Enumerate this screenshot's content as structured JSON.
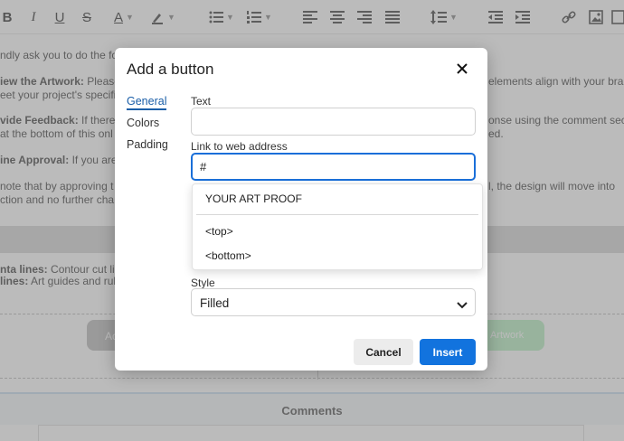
{
  "document": {
    "lines": [
      {
        "text": "ndly ask you to do the foll",
        "bold": false
      },
      {
        "text": "iew the Artwork:",
        "bold": true,
        "rest": " Please"
      },
      {
        "text": "eet your project's specifi",
        "bold": false
      },
      {
        "text": "vide Feedback:",
        "bold": true,
        "rest": " If there a"
      },
      {
        "text": "at the bottom of this onl",
        "bold": false
      },
      {
        "text": "ine Approval:",
        "bold": true,
        "rest": " If you are"
      },
      {
        "text": " note that by approving t",
        "bold": false
      },
      {
        "text": "ction and no further chan",
        "bold": false
      },
      {
        "text": "nta lines:",
        "bold": true,
        "rest": " Contour cut lin"
      },
      {
        "text": "lines:",
        "bold": true,
        "rest": " Art guides and rule"
      }
    ],
    "right_lines": [
      "elements align with your bran",
      "onse using the comment secti",
      "ed.",
      "l, the design will move into"
    ],
    "bg_button_left": "Ac",
    "bg_button_right": "Artwork",
    "comments_heading": "Comments"
  },
  "dialog": {
    "title": "Add a button",
    "tabs": [
      "General",
      "Colors",
      "Padding"
    ],
    "text_label": "Text",
    "text_value": "",
    "link_label": "Link to web address",
    "link_value": "#",
    "dropdown_items": [
      "YOUR ART PROOF",
      "<top>",
      "<bottom>"
    ],
    "style_label": "Style",
    "style_value": "Filled",
    "cancel_label": "Cancel",
    "insert_label": "Insert"
  },
  "colors": {
    "accent": "#1273de",
    "focus": "#1a6fd9",
    "tab_active": "#1a5ea8"
  }
}
